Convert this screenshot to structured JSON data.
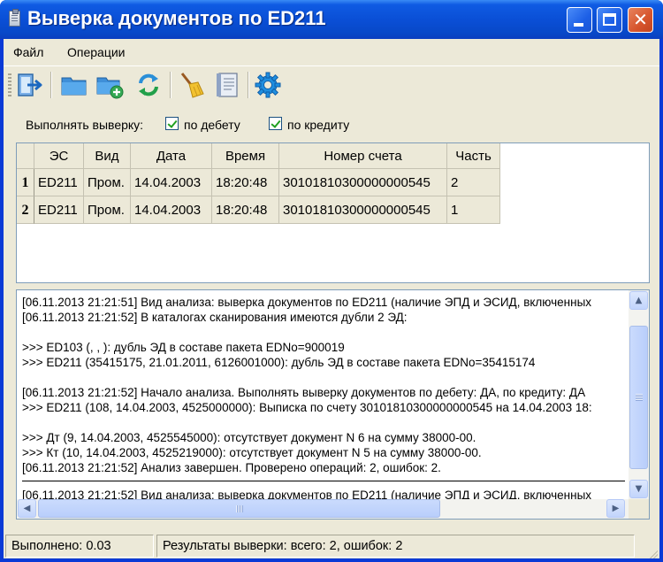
{
  "window": {
    "title": "Выверка документов по ED211"
  },
  "menu": {
    "items": [
      "Файл",
      "Операции"
    ]
  },
  "toolbar": {
    "icons": [
      "exit-icon",
      "folder-open-icon",
      "folder-add-icon",
      "refresh-icon",
      "clear-broom-icon",
      "notebook-icon",
      "settings-gear-icon"
    ]
  },
  "options": {
    "label": "Выполнять выверку:",
    "debit": {
      "label": "по дебету",
      "checked": true
    },
    "credit": {
      "label": "по кредиту",
      "checked": true
    }
  },
  "grid": {
    "columns": [
      "ЭС",
      "Вид",
      "Дата",
      "Время",
      "Номер счета",
      "Часть"
    ],
    "rows": [
      {
        "num": "1",
        "cells": [
          "ED211",
          "Пром.",
          "14.04.2003",
          "18:20:48",
          "30101810300000000545",
          "2"
        ]
      },
      {
        "num": "2",
        "cells": [
          "ED211",
          "Пром.",
          "14.04.2003",
          "18:20:48",
          "30101810300000000545",
          "1"
        ]
      }
    ]
  },
  "log": {
    "lines": [
      "[06.11.2013 21:21:51] Вид анализа: выверка документов по ED211 (наличие ЭПД и ЭСИД, включенных",
      "[06.11.2013 21:21:52] В каталогах сканирования имеются дубли 2 ЭД:",
      "",
      ">>> ED103 (, , ): дубль ЭД в составе пакета EDNo=900019",
      ">>> ED211 (35415175, 21.01.2011, 6126001000): дубль ЭД в составе пакета EDNo=35415174",
      "",
      "[06.11.2013 21:21:52] Начало анализа. Выполнять выверку документов по дебету: ДА, по кредиту: ДА",
      ">>> ED211 (108, 14.04.2003, 4525000000): Выписка по счету 30101810300000000545 на 14.04.2003 18:",
      "",
      ">>> Дт (9, 14.04.2003, 4525545000): отсутствует документ N   6 на сумму 38000-00.",
      ">>> Кт (10, 14.04.2003, 4525219000): отсутствует документ N   5 на сумму 38000-00.",
      "[06.11.2013 21:21:52] Анализ завершен. Проверено операций: 2, ошибок: 2."
    ],
    "after_separator": [
      "[06.11.2013 21:21:52] Вид анализа: выверка документов по ED211 (наличие ЭПД и ЭСИД, включенных"
    ]
  },
  "status": {
    "done": "Выполнено: 0.03",
    "results": "Результаты выверки: всего: 2, ошибок: 2"
  },
  "colors": {
    "titlebar": "#0a4fd6",
    "face": "#ece9d8",
    "check": "#21a121"
  }
}
